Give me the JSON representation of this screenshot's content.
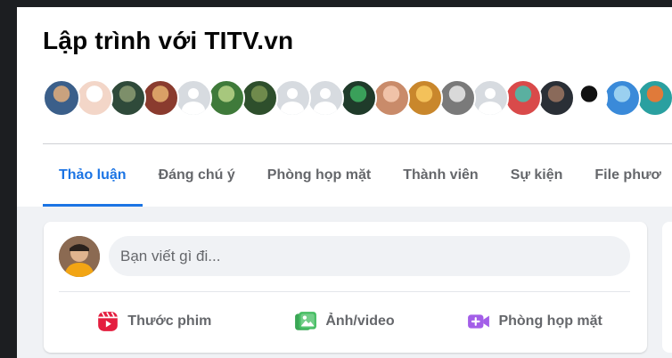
{
  "group": {
    "title": "Lập trình với TITV.vn"
  },
  "members": [
    {
      "kind": "photo",
      "colors": [
        "#3b5f8a",
        "#c9a27e"
      ]
    },
    {
      "kind": "photo",
      "colors": [
        "#f3d6c8",
        "#ffffff"
      ]
    },
    {
      "kind": "photo",
      "colors": [
        "#2f4a3a",
        "#7d8f6a"
      ]
    },
    {
      "kind": "photo",
      "colors": [
        "#8a3b2e",
        "#d9a066"
      ]
    },
    {
      "kind": "blank"
    },
    {
      "kind": "photo",
      "colors": [
        "#3f7a3a",
        "#a7c77d"
      ]
    },
    {
      "kind": "photo",
      "colors": [
        "#2e4f2c",
        "#6f8a4c"
      ]
    },
    {
      "kind": "blank"
    },
    {
      "kind": "blank"
    },
    {
      "kind": "photo",
      "colors": [
        "#1f3b2a",
        "#3aa05a"
      ]
    },
    {
      "kind": "photo",
      "colors": [
        "#c98b6a",
        "#f0c2a8"
      ]
    },
    {
      "kind": "photo",
      "colors": [
        "#c9872c",
        "#f3c15a"
      ]
    },
    {
      "kind": "photo",
      "colors": [
        "#7a7a7a",
        "#d9d9d9"
      ]
    },
    {
      "kind": "blank"
    },
    {
      "kind": "photo",
      "colors": [
        "#d94a4a",
        "#5ab0a0"
      ]
    },
    {
      "kind": "photo",
      "colors": [
        "#2a2f36",
        "#8a6a5a"
      ]
    },
    {
      "kind": "photo",
      "colors": [
        "#ffffff",
        "#111111"
      ]
    },
    {
      "kind": "photo",
      "colors": [
        "#3a8ad9",
        "#9ad0f0"
      ]
    },
    {
      "kind": "photo",
      "colors": [
        "#2aa0a0",
        "#e07a3a"
      ]
    },
    {
      "kind": "photo",
      "colors": [
        "#5a3a2a",
        "#b07a5a"
      ]
    }
  ],
  "tabs": [
    {
      "label": "Thảo luận",
      "active": true
    },
    {
      "label": "Đáng chú ý",
      "active": false
    },
    {
      "label": "Phòng họp mặt",
      "active": false
    },
    {
      "label": "Thành viên",
      "active": false
    },
    {
      "label": "Sự kiện",
      "active": false
    },
    {
      "label": "File phươ",
      "active": false
    }
  ],
  "composer": {
    "placeholder": "Bạn viết gì đi...",
    "actions": [
      {
        "label": "Thước phim",
        "icon": "reel-icon",
        "color": "#e41e3f"
      },
      {
        "label": "Ảnh/video",
        "icon": "photo-video-icon",
        "color": "#45bd62"
      },
      {
        "label": "Phòng họp mặt",
        "icon": "video-room-icon",
        "color": "#a35ee8"
      }
    ]
  },
  "colors": {
    "accent": "#1b74e4",
    "background": "#f0f2f5",
    "text_secondary": "#65676b"
  }
}
